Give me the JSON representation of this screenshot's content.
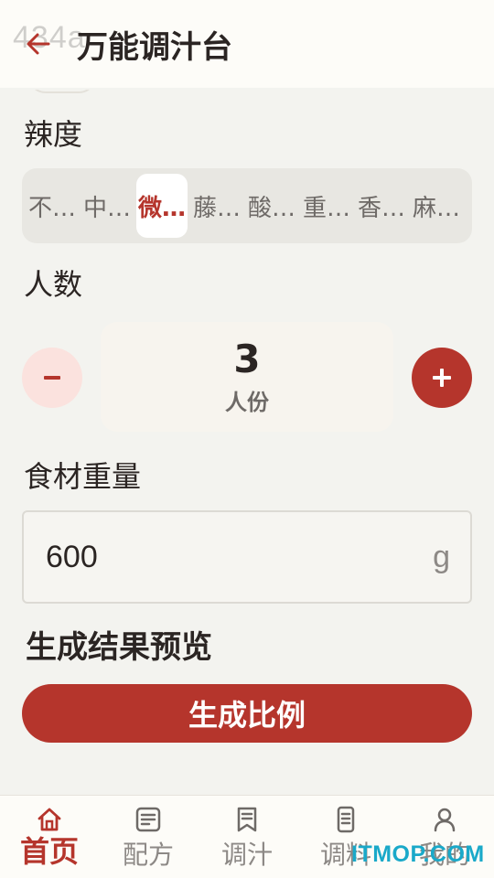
{
  "header": {
    "watermark": "434a",
    "title": "万能调汁台"
  },
  "spice": {
    "label": "辣度",
    "options": [
      "不…",
      "中…",
      "微…",
      "藤…",
      "酸…",
      "重…",
      "香…",
      "麻…"
    ],
    "selected_index": 2
  },
  "servings": {
    "label": "人数",
    "value": "3",
    "unit": "人份",
    "minus_label": "−",
    "plus_label": "+"
  },
  "weight": {
    "label": "食材重量",
    "value": "600",
    "unit": "g"
  },
  "preview": {
    "title": "生成结果预览"
  },
  "generate_button": "生成比例",
  "tabbar": {
    "items": [
      {
        "label": "首页",
        "icon": "home-icon",
        "active": true
      },
      {
        "label": "配方",
        "icon": "recipe-icon",
        "active": false
      },
      {
        "label": "调汁",
        "icon": "bookmark-doc-icon",
        "active": false
      },
      {
        "label": "调料",
        "icon": "phone-list-icon",
        "active": false
      },
      {
        "label": "我的",
        "icon": "user-icon",
        "active": false
      }
    ]
  },
  "site_watermark": "ITMOP.COM",
  "colors": {
    "accent": "#b5352c",
    "background": "#f3f3ef",
    "accent_light": "#fbe2de"
  }
}
